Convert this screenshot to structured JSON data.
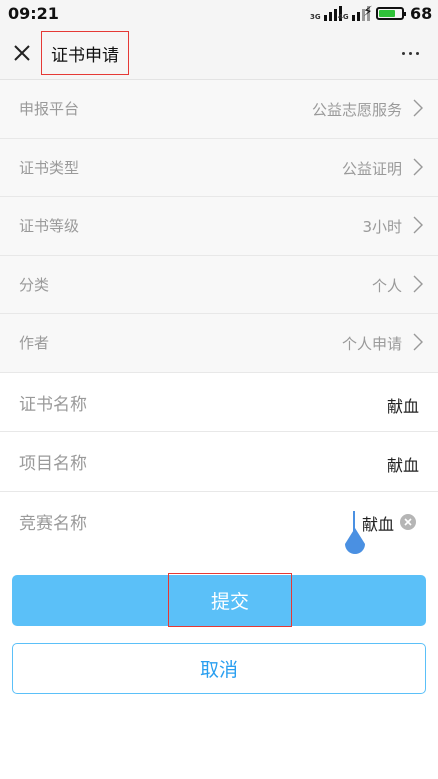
{
  "status_bar": {
    "time": "09:21",
    "signal1_label": "3G",
    "signal2_label": "4G",
    "battery_level": "68",
    "battery_color": "#2fc239"
  },
  "navbar": {
    "title": "证书申请",
    "close_icon": "close-icon",
    "more_icon": "more-dots-icon"
  },
  "form": {
    "select_rows": [
      {
        "label": "申报平台",
        "value": "公益志愿服务"
      },
      {
        "label": "证书类型",
        "value": "公益证明"
      },
      {
        "label": "证书等级",
        "value": "3小时"
      },
      {
        "label": "分类",
        "value": "个人"
      },
      {
        "label": "作者",
        "value": "个人申请"
      }
    ],
    "input_rows": [
      {
        "label": "证书名称",
        "value": "献血"
      },
      {
        "label": "项目名称",
        "value": "献血"
      },
      {
        "label": "竞赛名称",
        "value": "献血"
      }
    ]
  },
  "buttons": {
    "submit_label": "提交",
    "cancel_label": "取消",
    "accent_color": "#5bc0f8"
  }
}
